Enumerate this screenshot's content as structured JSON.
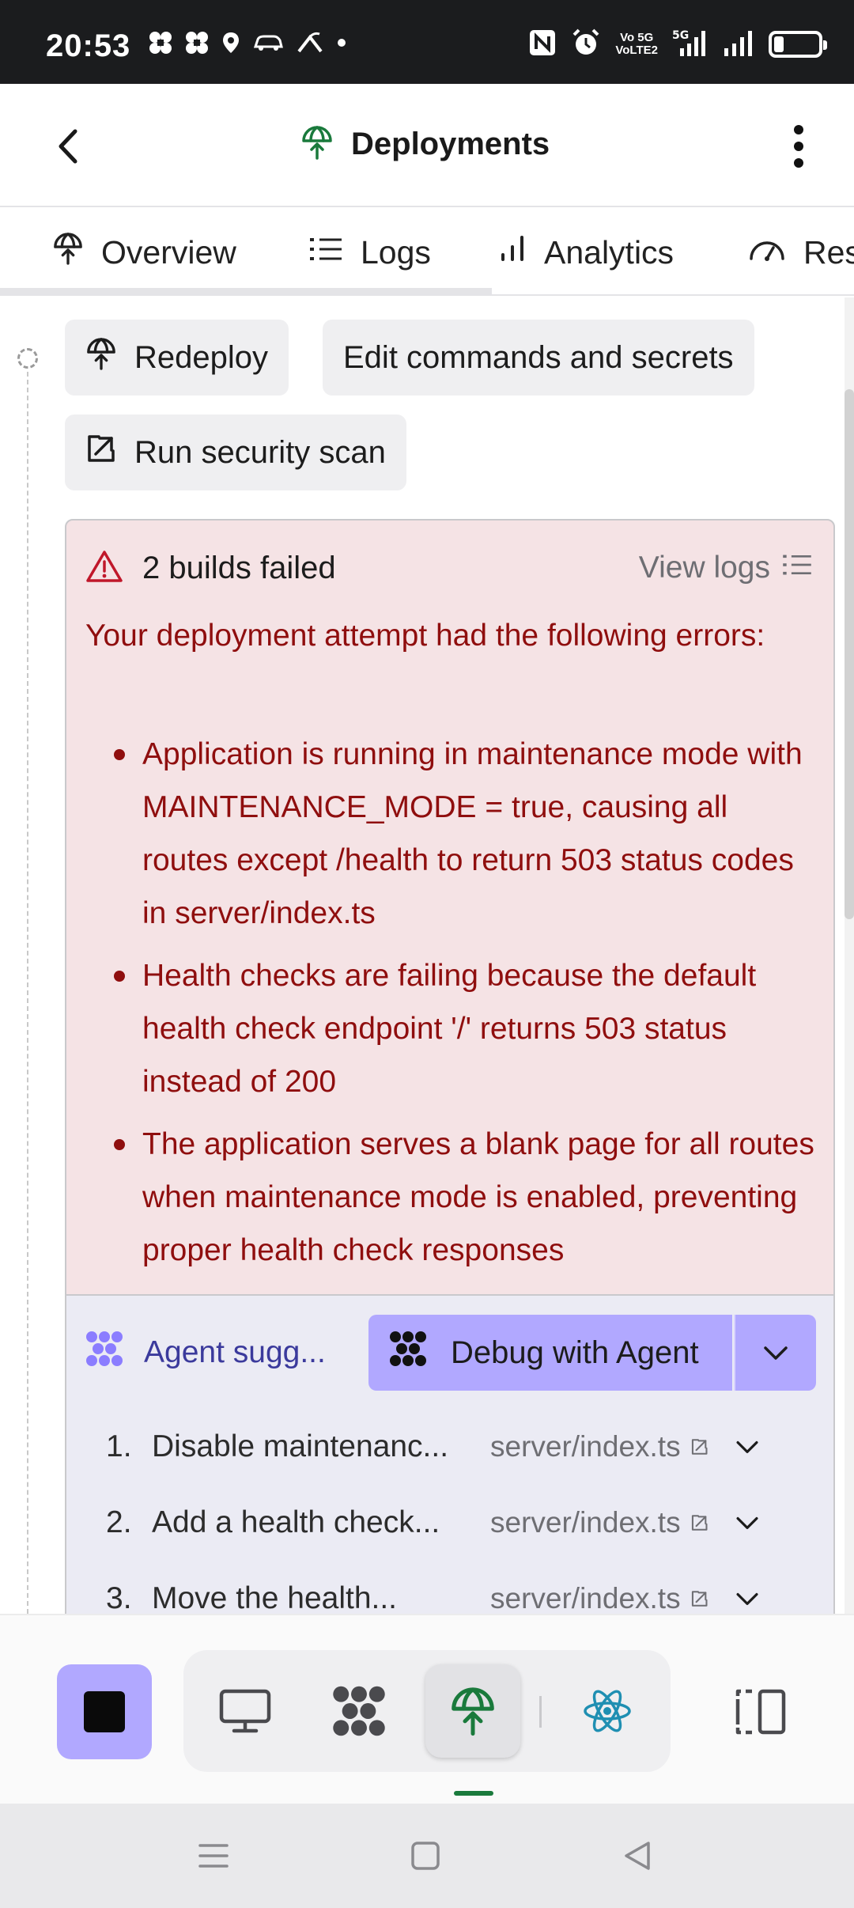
{
  "status_bar": {
    "time": "20:53",
    "volte_line1": "Vo 5G",
    "volte_line2": "VoLTE2",
    "network": "5G",
    "icons": [
      "hashtag-icon",
      "hashtag-icon",
      "location-icon",
      "car-icon",
      "router-icon",
      "dot-icon",
      "nfc-icon",
      "alarm-icon",
      "signal-icon",
      "signal-icon",
      "battery-icon"
    ]
  },
  "header": {
    "title": "Deployments",
    "icon": "deployments-icon",
    "accent": "#1a7a3c"
  },
  "tabs": [
    {
      "label": "Overview",
      "icon": "deployments-icon",
      "active": true
    },
    {
      "label": "Logs",
      "icon": "list-icon"
    },
    {
      "label": "Analytics",
      "icon": "bar-chart-icon"
    },
    {
      "label": "Res",
      "icon": "gauge-icon"
    }
  ],
  "actions": {
    "redeploy": "Redeploy",
    "edit_commands": "Edit commands and secrets",
    "security_scan": "Run security scan"
  },
  "error_card": {
    "title": "2 builds failed",
    "view_logs": "View logs",
    "description": "Your deployment attempt had the following errors:",
    "errors": [
      "Application is running in maintenance mode with MAINTENANCE_MODE = true, causing all routes except /health to return 503 status codes in server/index.ts",
      "Health checks are failing because the default health check endpoint '/' returns 503 status instead of 200",
      "The application serves a blank page for all routes when maintenance mode is enabled, preventing proper health check responses"
    ],
    "colors": {
      "background": "#f5e3e5",
      "text": "#8f0e0e"
    }
  },
  "agent": {
    "suggestions_label": "Agent sugg...",
    "debug_button": "Debug with Agent",
    "accent": "#b1a8ff",
    "suggestions": [
      {
        "num": "1.",
        "text": "Disable maintenanc...",
        "file": "server/index.ts"
      },
      {
        "num": "2.",
        "text": "Add a health check...",
        "file": "server/index.ts"
      },
      {
        "num": "3.",
        "text": "Move the health...",
        "file": "server/index.ts"
      }
    ]
  },
  "toolbar": {
    "stop_icon": "stop-icon",
    "tools": [
      "monitor-icon",
      "agent-icon",
      "deployments-icon",
      "react-icon"
    ],
    "active_tool": "deployments-icon",
    "split_icon": "split-view-icon"
  },
  "system_nav": [
    "menu-icon",
    "home-icon",
    "back-icon"
  ]
}
